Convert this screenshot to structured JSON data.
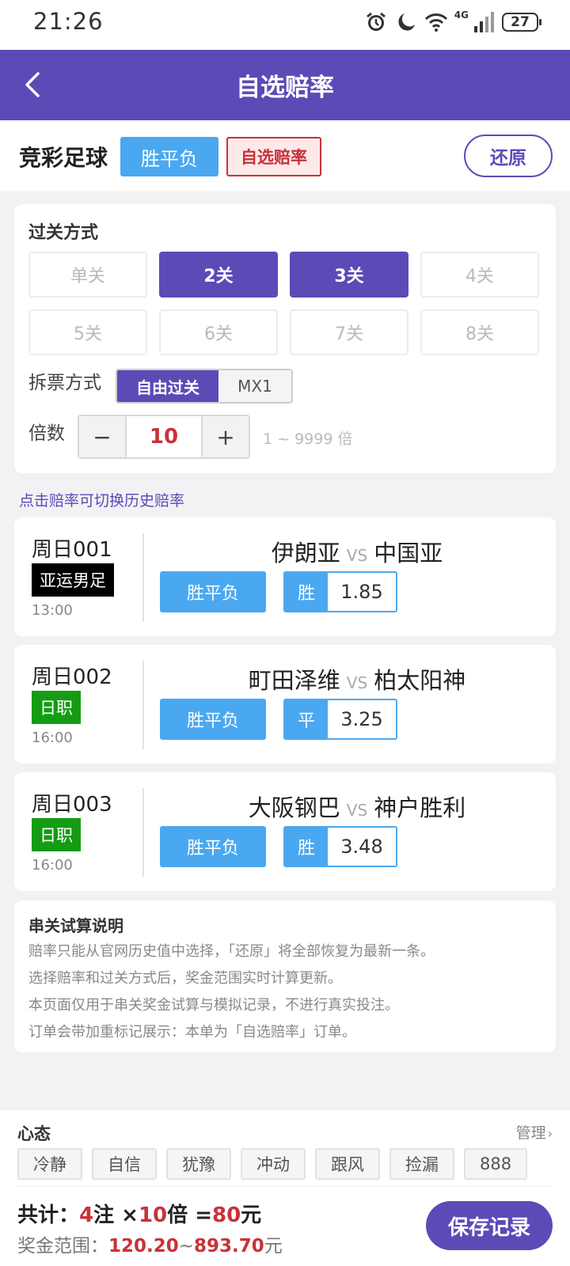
{
  "status": {
    "time": "21:26",
    "network": "4G",
    "battery": "27"
  },
  "nav": {
    "title": "自选赔率"
  },
  "header": {
    "sport": "竞彩足球",
    "play_type": "胜平负",
    "mode_tag": "自选赔率",
    "restore": "还原"
  },
  "pass": {
    "title": "过关方式",
    "options": [
      {
        "label": "单关",
        "active": false
      },
      {
        "label": "2关",
        "active": true
      },
      {
        "label": "3关",
        "active": true
      },
      {
        "label": "4关",
        "active": false
      },
      {
        "label": "5关",
        "active": false
      },
      {
        "label": "6关",
        "active": false
      },
      {
        "label": "7关",
        "active": false
      },
      {
        "label": "8关",
        "active": false
      }
    ],
    "split_label": "拆票方式",
    "split_options": [
      "自由过关",
      "MX1"
    ],
    "split_selected": "自由过关",
    "multiple_label": "倍数",
    "multiple_minus": "−",
    "multiple_value": "10",
    "multiple_plus": "+",
    "multiple_range": "1 ~ 9999 倍"
  },
  "hint": "点击赔率可切换历史赔率",
  "matches": [
    {
      "date": "周日001",
      "league": "亚运男足",
      "league_color": "#000000",
      "time": "13:00",
      "home": "伊朗亚",
      "vs": "VS",
      "away": "中国亚",
      "type": "胜平负",
      "selection": "胜",
      "odds": "1.85"
    },
    {
      "date": "周日002",
      "league": "日职",
      "league_color": "#149c14",
      "time": "16:00",
      "home": "町田泽维",
      "vs": "VS",
      "away": "柏太阳神",
      "type": "胜平负",
      "selection": "平",
      "odds": "3.25"
    },
    {
      "date": "周日003",
      "league": "日职",
      "league_color": "#149c14",
      "time": "16:00",
      "home": "大阪钢巴",
      "vs": "VS",
      "away": "神户胜利",
      "type": "胜平负",
      "selection": "胜",
      "odds": "3.48"
    }
  ],
  "info": {
    "title": "串关试算说明",
    "lines": [
      "赔率只能从官网历史值中选择，「还原」将全部恢复为最新一条。",
      "选择赔率和过关方式后，奖金范围实时计算更新。",
      "本页面仅用于串关奖金试算与模拟记录，不进行真实投注。",
      "订单会带加重标记展示：本单为「自选赔率」订单。"
    ]
  },
  "mood": {
    "title": "心态",
    "manage": "管理",
    "tags": [
      "冷静",
      "自信",
      "犹豫",
      "冲动",
      "跟风",
      "捡漏",
      "888"
    ]
  },
  "summary": {
    "total_prefix": "共计：",
    "bets": "4",
    "bets_unit": "注 ×",
    "multiple": "10",
    "multiple_unit": "倍 =",
    "amount": "80",
    "amount_unit": "元",
    "prize_label": "奖金范围：",
    "prize_min": "120.20",
    "prize_sep": "~",
    "prize_max": "893.70",
    "prize_unit": "元",
    "save": "保存记录"
  },
  "colors": {
    "primary": "#5a4bb7",
    "blue": "#4aa8f0",
    "red": "#c8323a"
  }
}
